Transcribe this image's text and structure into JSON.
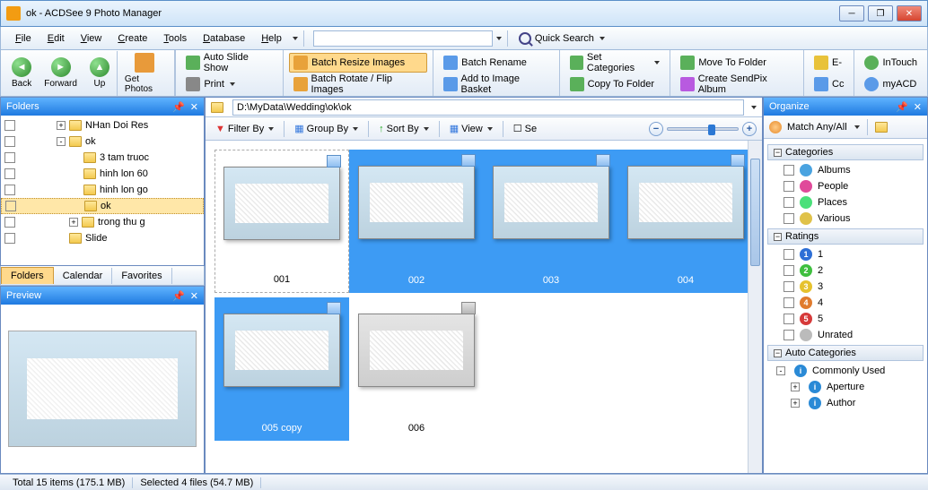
{
  "window": {
    "title": "ok - ACDSee 9 Photo Manager"
  },
  "menu": {
    "items": [
      "File",
      "Edit",
      "View",
      "Create",
      "Tools",
      "Database",
      "Help"
    ],
    "quick_search": "Quick Search"
  },
  "nav": {
    "back": "Back",
    "forward": "Forward",
    "up": "Up",
    "get_photos": "Get Photos"
  },
  "toolbar": {
    "auto_slide": "Auto Slide Show",
    "print": "Print",
    "batch_resize": "Batch Resize Images",
    "batch_rotate": "Batch Rotate / Flip Images",
    "batch_rename": "Batch Rename",
    "add_basket": "Add to Image Basket",
    "set_categories": "Set Categories",
    "copy_to": "Copy To Folder",
    "move_to": "Move To Folder",
    "sendpix": "Create SendPix Album",
    "e": "E-",
    "cc": "Cc",
    "intouch": "InTouch",
    "myacd": "myACD"
  },
  "folders": {
    "title": "Folders",
    "tree": [
      {
        "indent": 40,
        "exp": "+",
        "name": "NHan Doi Res"
      },
      {
        "indent": 40,
        "exp": "-",
        "name": "ok"
      },
      {
        "indent": 70,
        "exp": "",
        "name": "3 tam truoc"
      },
      {
        "indent": 70,
        "exp": "",
        "name": "hinh lon 60"
      },
      {
        "indent": 70,
        "exp": "",
        "name": "hinh lon go"
      },
      {
        "indent": 70,
        "exp": "",
        "name": "ok",
        "sel": true
      },
      {
        "indent": 54,
        "exp": "+",
        "name": "trong thu g"
      },
      {
        "indent": 54,
        "exp": "",
        "name": "Slide"
      }
    ],
    "tabs": [
      "Folders",
      "Calendar",
      "Favorites"
    ]
  },
  "preview": {
    "title": "Preview"
  },
  "center": {
    "path": "D:\\MyData\\Wedding\\ok\\ok",
    "filter": "Filter By",
    "group": "Group By",
    "sort": "Sort By",
    "view": "View",
    "se": "Se",
    "thumbs": [
      {
        "name": "001",
        "sel": false,
        "focus": true
      },
      {
        "name": "002",
        "sel": true
      },
      {
        "name": "003",
        "sel": true
      },
      {
        "name": "004",
        "sel": true
      },
      {
        "name": "005 copy",
        "sel": true
      },
      {
        "name": "006",
        "sel": false,
        "mono": true
      }
    ]
  },
  "organize": {
    "title": "Organize",
    "match": "Match Any/All",
    "categories_hdr": "Categories",
    "categories": [
      {
        "name": "Albums",
        "color": "#4aa3e0"
      },
      {
        "name": "People",
        "color": "#e04a9a"
      },
      {
        "name": "Places",
        "color": "#4ae07a"
      },
      {
        "name": "Various",
        "color": "#e0c24a"
      }
    ],
    "ratings_hdr": "Ratings",
    "ratings": [
      {
        "n": "1",
        "color": "#2e6fd6"
      },
      {
        "n": "2",
        "color": "#3fbf3f"
      },
      {
        "n": "3",
        "color": "#e6c22e"
      },
      {
        "n": "4",
        "color": "#e07b2e"
      },
      {
        "n": "5",
        "color": "#d63a3a"
      }
    ],
    "unrated": "Unrated",
    "auto_hdr": "Auto Categories",
    "common": "Commonly Used",
    "aperture": "Aperture",
    "author": "Author"
  },
  "status": {
    "total": "Total 15 items  (175.1 MB)",
    "selected": "Selected 4 files (54.7 MB)"
  }
}
